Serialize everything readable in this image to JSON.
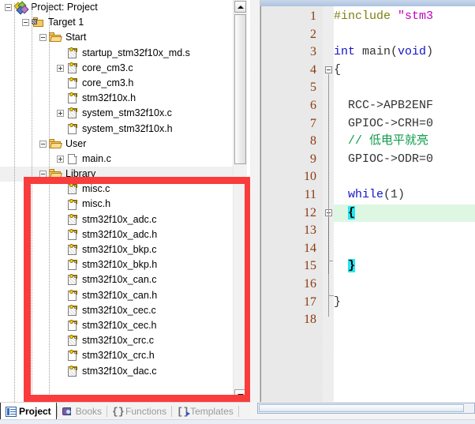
{
  "project_pane": {
    "tree": [
      {
        "depth": 0,
        "label": "Project: Project",
        "icon": "project-icon",
        "twisty": "minus"
      },
      {
        "depth": 1,
        "label": "Target 1",
        "icon": "target-icon",
        "twisty": "minus"
      },
      {
        "depth": 2,
        "label": "Start",
        "icon": "folder-icon",
        "twisty": "minus"
      },
      {
        "depth": 3,
        "label": "startup_stm32f10x_md.s",
        "icon": "source-file-icon",
        "twisty": "none"
      },
      {
        "depth": 3,
        "label": "core_cm3.c",
        "icon": "source-file-icon",
        "twisty": "plus"
      },
      {
        "depth": 3,
        "label": "core_cm3.h",
        "icon": "header-file-icon",
        "twisty": "none"
      },
      {
        "depth": 3,
        "label": "stm32f10x.h",
        "icon": "header-file-icon",
        "twisty": "none"
      },
      {
        "depth": 3,
        "label": "system_stm32f10x.c",
        "icon": "source-file-icon",
        "twisty": "plus"
      },
      {
        "depth": 3,
        "label": "system_stm32f10x.h",
        "icon": "header-file-icon",
        "twisty": "none"
      },
      {
        "depth": 2,
        "label": "User",
        "icon": "folder-icon",
        "twisty": "minus"
      },
      {
        "depth": 3,
        "label": "main.c",
        "icon": "plain-file-icon",
        "twisty": "plus"
      },
      {
        "depth": 2,
        "label": "Library",
        "icon": "folder-icon",
        "twisty": "minus",
        "selected": true
      },
      {
        "depth": 3,
        "label": "misc.c",
        "icon": "source-file-icon",
        "twisty": "none"
      },
      {
        "depth": 3,
        "label": "misc.h",
        "icon": "header-file-icon",
        "twisty": "none"
      },
      {
        "depth": 3,
        "label": "stm32f10x_adc.c",
        "icon": "source-file-icon",
        "twisty": "none"
      },
      {
        "depth": 3,
        "label": "stm32f10x_adc.h",
        "icon": "header-file-icon",
        "twisty": "none"
      },
      {
        "depth": 3,
        "label": "stm32f10x_bkp.c",
        "icon": "source-file-icon",
        "twisty": "none"
      },
      {
        "depth": 3,
        "label": "stm32f10x_bkp.h",
        "icon": "header-file-icon",
        "twisty": "none"
      },
      {
        "depth": 3,
        "label": "stm32f10x_can.c",
        "icon": "source-file-icon",
        "twisty": "none"
      },
      {
        "depth": 3,
        "label": "stm32f10x_can.h",
        "icon": "header-file-icon",
        "twisty": "none"
      },
      {
        "depth": 3,
        "label": "stm32f10x_cec.c",
        "icon": "source-file-icon",
        "twisty": "none"
      },
      {
        "depth": 3,
        "label": "stm32f10x_cec.h",
        "icon": "header-file-icon",
        "twisty": "none"
      },
      {
        "depth": 3,
        "label": "stm32f10x_crc.c",
        "icon": "source-file-icon",
        "twisty": "none"
      },
      {
        "depth": 3,
        "label": "stm32f10x_crc.h",
        "icon": "header-file-icon",
        "twisty": "none"
      },
      {
        "depth": 3,
        "label": "stm32f10x_dac.c",
        "icon": "source-file-icon",
        "twisty": "none"
      }
    ],
    "scrollbar": {
      "up_arrow": "▲",
      "down_arrow": "▼"
    }
  },
  "annotation": {
    "shape": "rectangle",
    "color": "#fa3c3c",
    "target": "Library"
  },
  "tabbar": {
    "tabs": [
      {
        "label": "Project",
        "icon": "project-tree-icon",
        "active": true
      },
      {
        "label": "Books",
        "icon": "books-icon",
        "active": false
      },
      {
        "label": "Functions",
        "icon": "braces-icon",
        "active": false
      },
      {
        "label": "Templates",
        "icon": "templates-icon",
        "active": false
      }
    ]
  },
  "editor": {
    "lines": [
      {
        "n": "1",
        "segments": [
          {
            "t": "#include ",
            "c": "pp"
          },
          {
            "t": "\"stm3",
            "c": "str"
          }
        ]
      },
      {
        "n": "2",
        "segments": []
      },
      {
        "n": "3",
        "segments": [
          {
            "t": "int ",
            "c": "kw"
          },
          {
            "t": "main",
            "c": "num"
          },
          {
            "t": "(",
            "c": "num"
          },
          {
            "t": "void",
            "c": "kw"
          },
          {
            "t": ")",
            "c": "num"
          }
        ]
      },
      {
        "n": "4",
        "segments": [
          {
            "t": "{",
            "c": "num"
          }
        ],
        "fold": true
      },
      {
        "n": "5",
        "segments": []
      },
      {
        "n": "6",
        "segments": [
          {
            "t": "  RCC->APB2ENF",
            "c": "num"
          }
        ]
      },
      {
        "n": "7",
        "segments": [
          {
            "t": "  GPIOC->CRH=0",
            "c": "num"
          }
        ]
      },
      {
        "n": "8",
        "segments": [
          {
            "t": "  // 低电平就亮",
            "c": "cm"
          }
        ]
      },
      {
        "n": "9",
        "segments": [
          {
            "t": "  GPIOC->ODR=0",
            "c": "num"
          }
        ]
      },
      {
        "n": "10",
        "segments": []
      },
      {
        "n": "11",
        "segments": [
          {
            "t": "  ",
            "c": "num"
          },
          {
            "t": "while",
            "c": "kw"
          },
          {
            "t": "(1)",
            "c": "num"
          }
        ]
      },
      {
        "n": "12",
        "segments": [
          {
            "t": "  ",
            "c": "num"
          },
          {
            "t": "{",
            "c": "brace-hi"
          }
        ],
        "fold": true,
        "current": true
      },
      {
        "n": "13",
        "segments": []
      },
      {
        "n": "14",
        "segments": []
      },
      {
        "n": "15",
        "segments": [
          {
            "t": "  ",
            "c": "num"
          },
          {
            "t": "}",
            "c": "brace-hi"
          }
        ]
      },
      {
        "n": "16",
        "segments": []
      },
      {
        "n": "17",
        "segments": [
          {
            "t": "}",
            "c": "num"
          }
        ]
      },
      {
        "n": "18",
        "segments": []
      }
    ]
  }
}
